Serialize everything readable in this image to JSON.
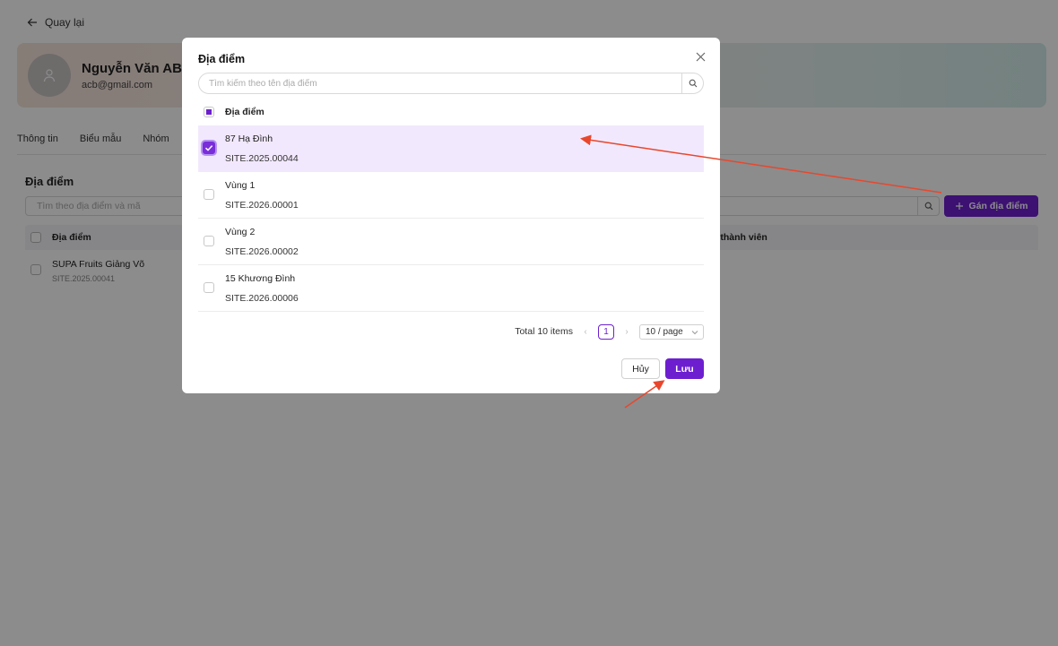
{
  "colors": {
    "accent": "#6d1fd0",
    "selected_row_bg": "#f2e8fd",
    "annotation_arrow": "#e8472d"
  },
  "back": {
    "label": "Quay lại",
    "icon": "arrow-left-icon"
  },
  "profile": {
    "name": "Nguyễn Văn ABC",
    "email": "acb@gmail.com",
    "avatar_icon": "user-icon"
  },
  "tabs": [
    "Thông tin",
    "Biểu mẫu",
    "Nhóm"
  ],
  "sites_section": {
    "title": "Địa điểm",
    "search_placeholder": "Tìm theo địa điểm và mã",
    "assign_button": "Gán địa điểm",
    "columns": [
      "Địa điểm",
      "ố thành viên"
    ],
    "rows": [
      {
        "name": "SUPA Fruits Giảng Võ",
        "code": "SITE.2025.00041"
      }
    ]
  },
  "modal": {
    "title": "Địa điểm",
    "search_placeholder": "Tìm kiếm theo tên địa điểm",
    "list_header": "Địa điểm",
    "items": [
      {
        "name": "87 Hạ Đình",
        "code": "SITE.2025.00044",
        "checked": true
      },
      {
        "name": "Vùng 1",
        "code": "SITE.2026.00001",
        "checked": false
      },
      {
        "name": "Vùng 2",
        "code": "SITE.2026.00002",
        "checked": false
      },
      {
        "name": "15 Khương Đình",
        "code": "SITE.2026.00006",
        "checked": false
      }
    ],
    "pagination": {
      "total_text": "Total 10 items",
      "current_page": "1",
      "page_size": "10 / page"
    },
    "cancel_label": "Hủy",
    "save_label": "Lưu"
  }
}
